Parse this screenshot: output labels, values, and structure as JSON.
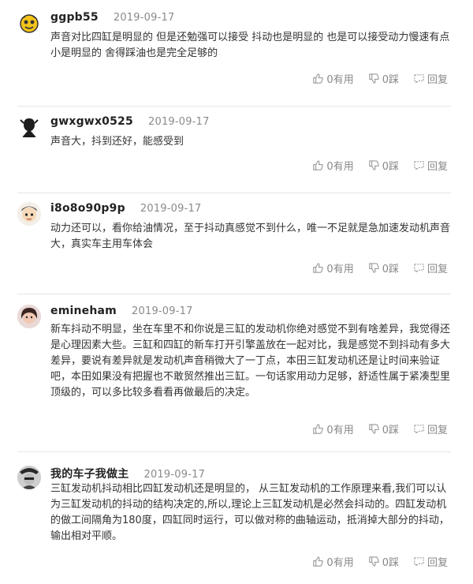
{
  "comments": [
    {
      "username": "ggpb55",
      "date": "2019-09-17",
      "content": "声音对比四缸是明显的 但是还勉强可以接受 抖动也是明显的 也是可以接受动力慢速有点小是明显的 舍得踩油也是完全足够的",
      "like": "0有用",
      "dislike": "0踩",
      "reply": "回复"
    },
    {
      "username": "gwxgwx0525",
      "date": "2019-09-17",
      "content": "声音大，抖到还好，能感受到",
      "like": "0有用",
      "dislike": "0踩",
      "reply": "回复"
    },
    {
      "username": "i8o8o90p9p",
      "date": "2019-09-17",
      "content": "动力还可以，看你给油情况，至于抖动真感觉不到什么，唯一不足就是急加速发动机声音大，真实车主用车体会",
      "like": "0有用",
      "dislike": "0踩",
      "reply": "回复"
    },
    {
      "username": "emineham",
      "date": "2019-09-17",
      "content": "新车抖动不明显，坐在车里不和你说是三缸的发动机你绝对感觉不到有啥差异，我觉得还是心理因素大些。三缸和四缸的新车打开引擎盖放在一起对比，我是感觉不到抖动有多大差异，要说有差异就是发动机声音稍微大了一丁点，本田三缸发动机还是让时间来验证吧，本田如果没有把握也不敢贸然推出三缸。一句话家用动力足够，舒适性属于紧凑型里顶级的，可以多比较多看看再做最后的决定。",
      "like": "0有用",
      "dislike": "0踩",
      "reply": "回复"
    },
    {
      "username": "我的车子我做主",
      "date": "2019-09-17",
      "content": "三缸发动机抖动相比四缸发动机还是明显的， 从三缸发动机的工作原理来看,我们可以认为三缸发动机的抖动的结构决定的,所以,理论上三缸发动机是必然会抖动的。四缸发动机的做工间隔角为180度，四缸同时运行，可以做对称的曲轴运动，抵消掉大部分的抖动，输出相对平顺。",
      "like": "0有用",
      "dislike": "0踩",
      "reply": "回复"
    }
  ],
  "icons": {
    "like": "thumb-up-icon",
    "dislike": "thumb-down-icon",
    "reply": "reply-icon"
  },
  "colors": {
    "action_text": "#888888",
    "date": "#8a8a8a",
    "divider": "#e5e5e5"
  }
}
